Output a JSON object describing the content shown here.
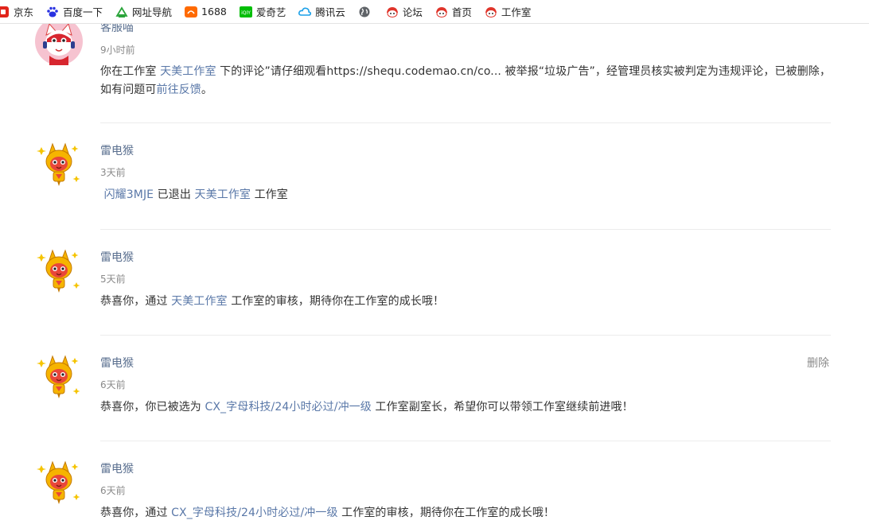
{
  "bookmarks": [
    {
      "label": "京东",
      "icon": "jd-icon"
    },
    {
      "label": "百度一下",
      "icon": "baidu-paw-icon"
    },
    {
      "label": "网址导航",
      "icon": "hao123-icon"
    },
    {
      "label": "1688",
      "icon": "1688-icon"
    },
    {
      "label": "爱奇艺",
      "icon": "iqiyi-icon"
    },
    {
      "label": "腾讯云",
      "icon": "tencent-cloud-icon"
    },
    {
      "label": "",
      "icon": "globe-icon"
    },
    {
      "label": "论坛",
      "icon": "codemao-icon"
    },
    {
      "label": "首页",
      "icon": "codemao-icon"
    },
    {
      "label": "工作室",
      "icon": "codemao-icon"
    }
  ],
  "notifications": [
    {
      "user": "客服喵",
      "time": "9小时前",
      "msg": {
        "p1": "你在工作室 ",
        "studio": "天美工作室",
        "p2": " 下的评论”请仔细观看https://shequ.codemao.cn/co...  被举报“垃圾广告”，经管理员核实被判定为违规评论，已被删除，如有问题可",
        "feedback": "前往反馈",
        "p3": "。"
      }
    },
    {
      "user": "雷电猴",
      "time": "3天前",
      "msg": {
        "user_link": "闪耀3MJE",
        "p1": " 已退出 ",
        "studio": "天美工作室",
        "p2": " 工作室"
      }
    },
    {
      "user": "雷电猴",
      "time": "5天前",
      "msg": {
        "p1": "恭喜你，通过 ",
        "studio": "天美工作室",
        "p2": " 工作室的审核，期待你在工作室的成长哦！"
      }
    },
    {
      "user": "雷电猴",
      "time": "6天前",
      "delete_label": "删除",
      "msg": {
        "p1": "恭喜你，你已被选为 ",
        "studio": "CX_字母科技/24小时必过/冲一级",
        "p2": " 工作室副室长，希望你可以带领工作室继续前进哦！"
      }
    },
    {
      "user": "雷电猴",
      "time": "6天前",
      "msg": {
        "p1": "恭喜你，通过 ",
        "studio": "CX_字母科技/24小时必过/冲一级",
        "p2": " 工作室的审核，期待你在工作室的成长哦！"
      }
    }
  ],
  "colors": {
    "link": "#5a78a8",
    "username": "#5a6f8f",
    "muted": "#8a8a8a",
    "text": "#333333",
    "divider": "#ececec"
  }
}
